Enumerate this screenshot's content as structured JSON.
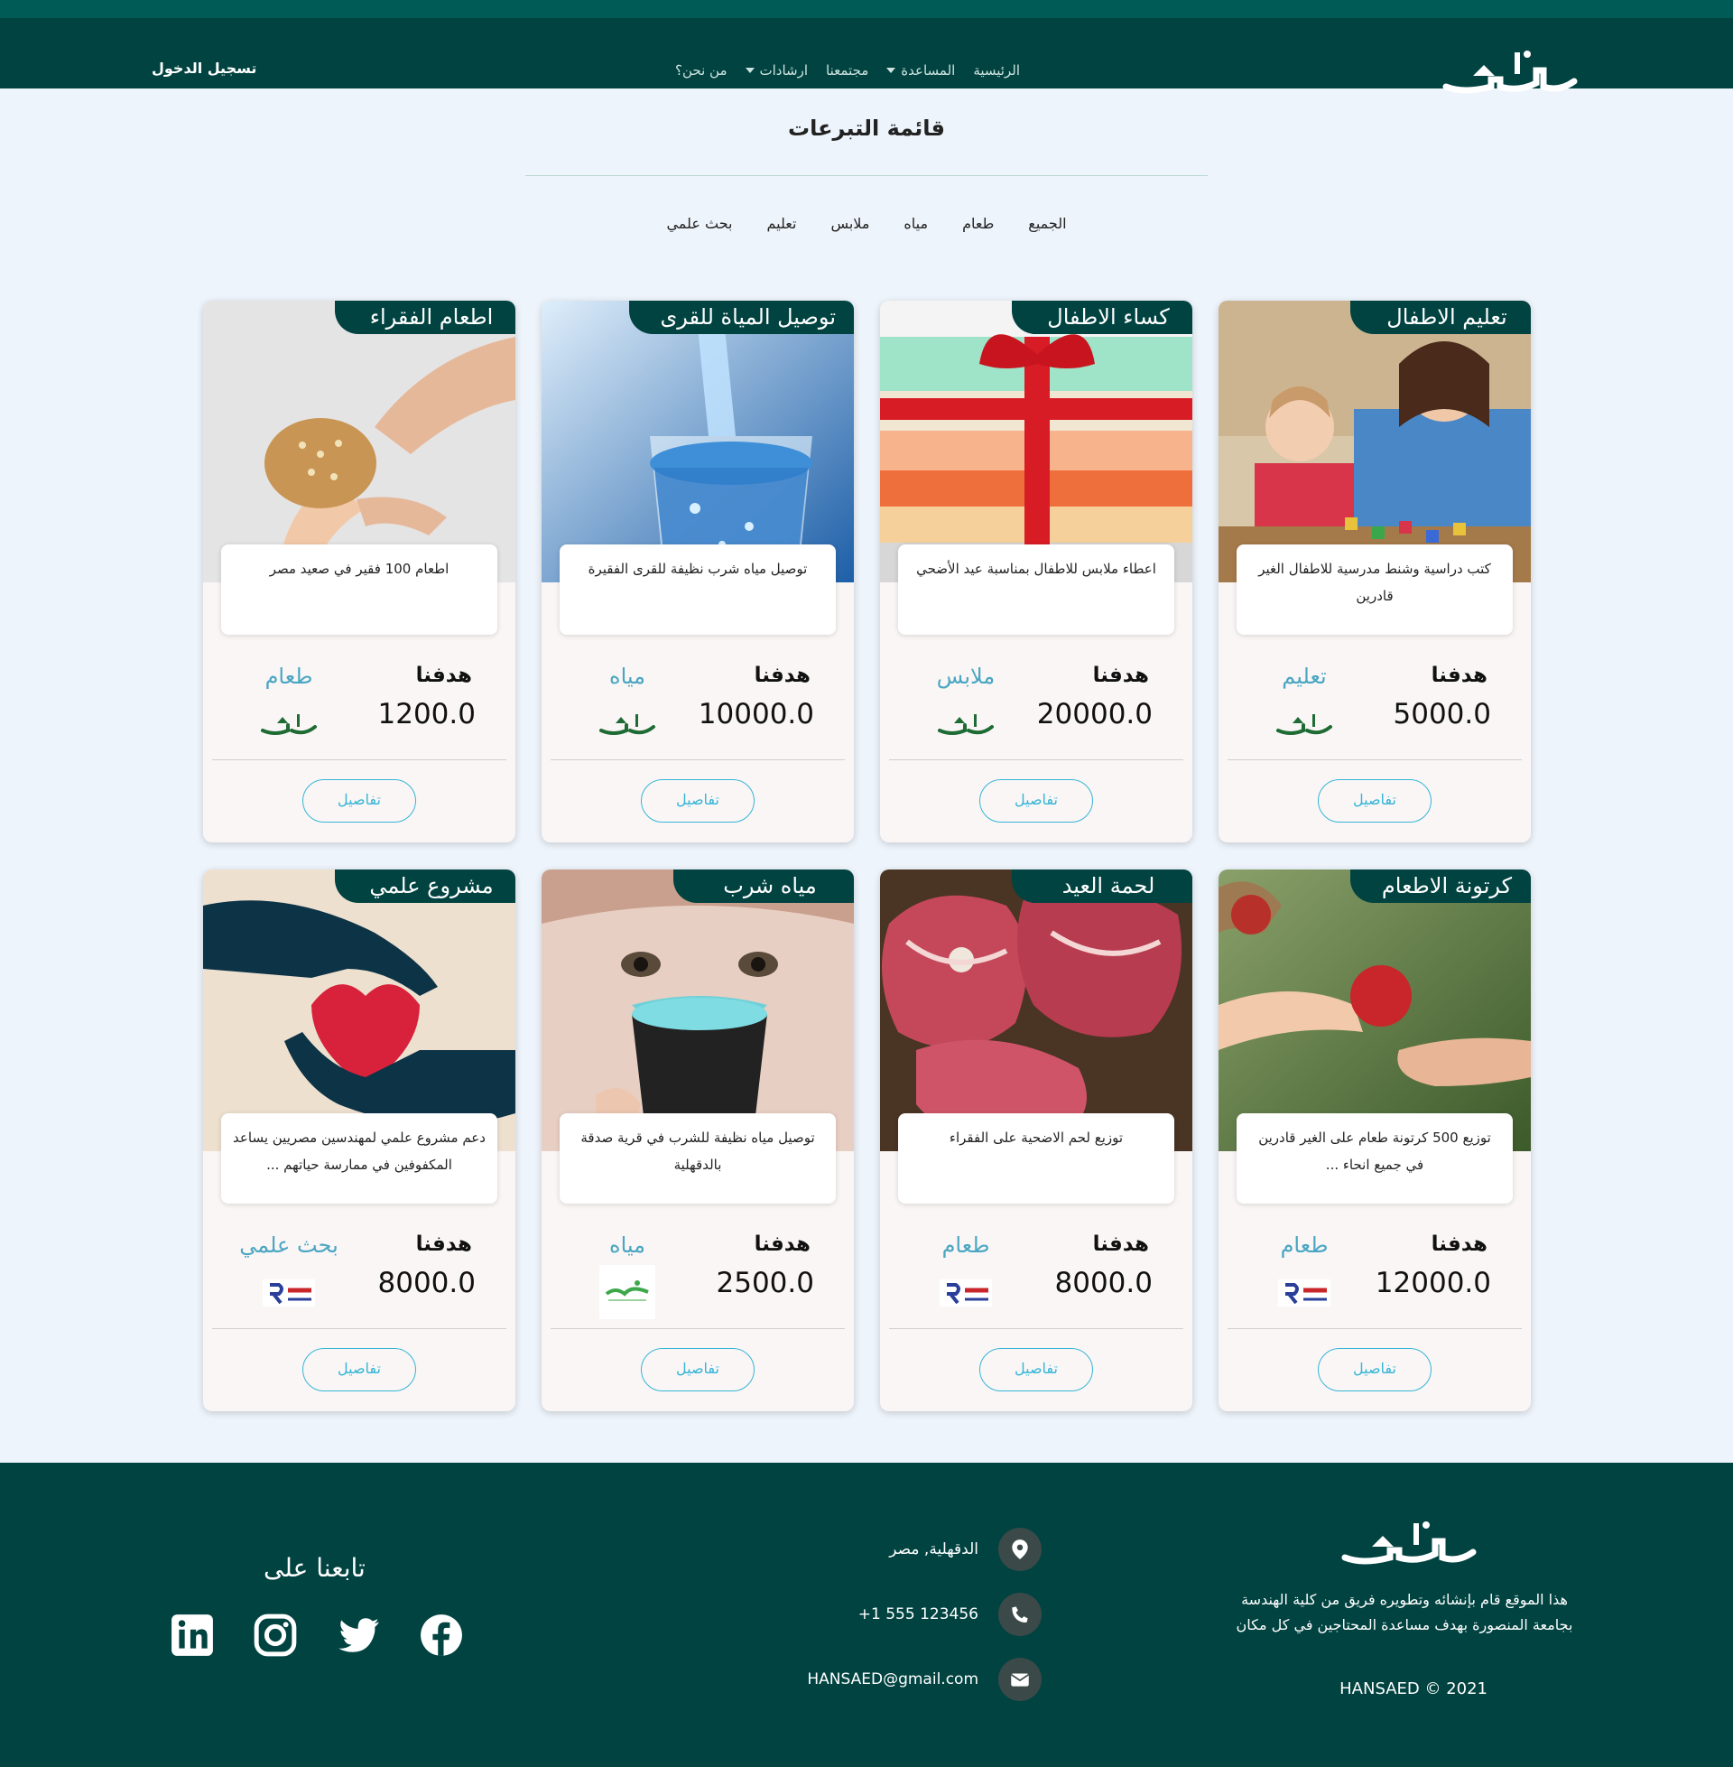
{
  "nav": {
    "login": "تسجيل الدخول",
    "links": [
      "الرئيسية",
      "المساعدة",
      "مجتمعنا",
      "ارشادات",
      "من نحن؟"
    ]
  },
  "page_title": "قائمة التبرعات",
  "filters": [
    "الجميع",
    "طعام",
    "مياه",
    "ملابس",
    "تعليم",
    "بحث علمي"
  ],
  "goal_label": "هدفنا",
  "details_label": "تفاصيل",
  "cards": [
    {
      "title": "تعليم الاطفال",
      "description": "كتب دراسية وشنط مدرسية للاطفال الغير قادرين",
      "category": "تعليم",
      "amount": "5000.0",
      "org": "hansaed"
    },
    {
      "title": "كساء الاطفال",
      "description": "اعطاء ملابس للاطفال بمناسبة عيد الأضحي",
      "category": "ملابس",
      "amount": "20000.0",
      "org": "hansaed"
    },
    {
      "title": "توصيل المياة للقرى",
      "description": "توصيل مياه شرب نظيفة للقرى الفقيرة",
      "category": "مياه",
      "amount": "10000.0",
      "org": "hansaed"
    },
    {
      "title": "اطعام الفقراء",
      "description": "اطعام 100 فقير في صعيد مصر",
      "category": "طعام",
      "amount": "1200.0",
      "org": "hansaed"
    },
    {
      "title": "كرتونة الاطعام",
      "description": "توزيع 500 كرتونة طعام على الغير قادرين في جميع انحاء ...",
      "category": "طعام",
      "amount": "12000.0",
      "org": "resala"
    },
    {
      "title": "لحمة العيد",
      "description": "توزيع لحم الاضحية على الفقراء",
      "category": "طعام",
      "amount": "8000.0",
      "org": "resala"
    },
    {
      "title": "مياه شرب",
      "description": "توصيل مياه نظيفة للشرب في قرية صدقة بالدقهلية",
      "category": "مياه",
      "amount": "2500.0",
      "org": "orman"
    },
    {
      "title": "مشروع علمي",
      "description": "دعم مشروع علمي لمهندسين مصريين يساعد المكفوفين في ممارسة حياتهم ...",
      "category": "بحث علمي",
      "amount": "8000.0",
      "org": "resala"
    }
  ],
  "footer": {
    "about": "هذا الموقع قام بإنشائه وتطويره فريق من كلية الهندسة بجامعة المنصورة بهدف مساعدة المحتاجين في كل مكان",
    "copyright": "HANSAED © 2021",
    "address": "الدقهلية, مصر",
    "phone": "+1 555 123456",
    "email": "HANSAED@gmail.com",
    "follow_title": "تابعنا على",
    "socials": [
      "facebook-icon",
      "twitter-icon",
      "instagram-icon",
      "linkedin-icon"
    ]
  },
  "colors": {
    "primary": "#004341",
    "accent": "#36b5d6",
    "category": "#4aa6c2",
    "background": "#eef4fb"
  }
}
